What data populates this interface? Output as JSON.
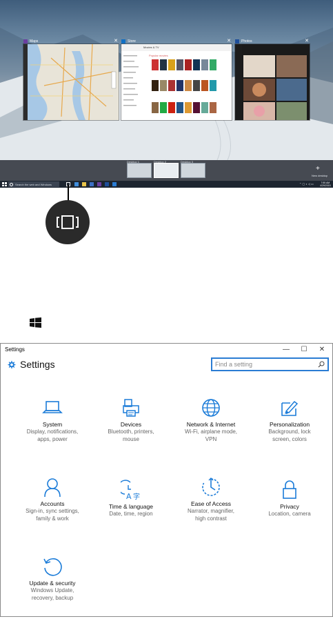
{
  "taskview": {
    "windows": [
      {
        "title": "Maps",
        "accent": "#4a2c7a"
      },
      {
        "title": "Store",
        "accent": "#0f6fc4"
      },
      {
        "title": "Photos",
        "accent": "#1e4e9a"
      }
    ],
    "store": {
      "filter_label": "Movies & TV",
      "section": "Popular movies"
    },
    "desktops": [
      "Desktop 1",
      "Desktop 2",
      "Desktop 3"
    ],
    "new_desktop_label": "New desktop",
    "taskbar": {
      "search_placeholder": "Search the web and Windows",
      "clock_time": "7:55 AM",
      "clock_date": "4/29/2015"
    }
  },
  "callout": {
    "icon": "task-view-icon"
  },
  "start_button": {
    "icon": "windows-logo-icon"
  },
  "settings": {
    "window_title": "Settings",
    "header_title": "Settings",
    "search_placeholder": "Find a setting",
    "accent": "#1a7bd8",
    "controls": {
      "minimize": "—",
      "maximize": "☐",
      "close": "✕"
    },
    "categories": [
      {
        "name": "System",
        "desc1": "Display, notifications,",
        "desc2": "apps, power",
        "icon": "laptop-icon"
      },
      {
        "name": "Devices",
        "desc1": "Bluetooth, printers,",
        "desc2": "mouse",
        "icon": "printer-icon"
      },
      {
        "name": "Network & Internet",
        "desc1": "Wi-Fi, airplane mode,",
        "desc2": "VPN",
        "icon": "globe-icon"
      },
      {
        "name": "Personalization",
        "desc1": "Background, lock",
        "desc2": "screen, colors",
        "icon": "paint-icon"
      },
      {
        "name": "Accounts",
        "desc1": "Sign-in, sync settings,",
        "desc2": "family & work",
        "icon": "person-icon"
      },
      {
        "name": "Time & language",
        "desc1": "Date, time, region",
        "desc2": "",
        "icon": "time-language-icon"
      },
      {
        "name": "Ease of Access",
        "desc1": "Narrator, magnifier,",
        "desc2": "high contrast",
        "icon": "ease-of-access-icon"
      },
      {
        "name": "Privacy",
        "desc1": "Location, camera",
        "desc2": "",
        "icon": "lock-icon"
      },
      {
        "name": "Update & security",
        "desc1": "Windows Update,",
        "desc2": "recovery, backup",
        "icon": "update-icon"
      }
    ]
  }
}
